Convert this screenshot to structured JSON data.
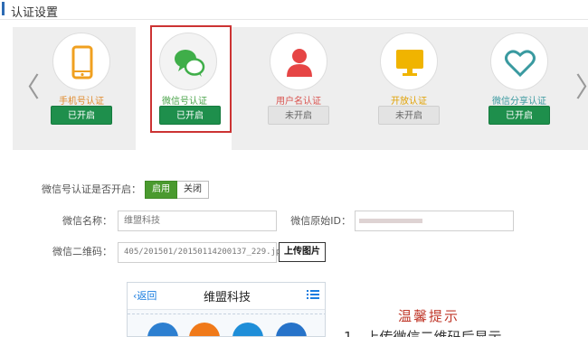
{
  "header": {
    "title": "认证设置"
  },
  "carousel": {
    "prev_arrow": "〈",
    "next_arrow": "〉",
    "cards": [
      {
        "icon": "phone-icon",
        "label": "手机号认证",
        "status": "已开启",
        "enabled": true,
        "label_color": "#e08a2c"
      },
      {
        "icon": "wechat-icon",
        "label": "微信号认证",
        "status": "已开启",
        "enabled": true,
        "label_color": "#4aa44a",
        "selected": true
      },
      {
        "icon": "user-icon",
        "label": "用户名认证",
        "status": "未开启",
        "enabled": false,
        "label_color": "#d9534f"
      },
      {
        "icon": "monitor-icon",
        "label": "开放认证",
        "status": "未开启",
        "enabled": false,
        "label_color": "#e0a000"
      },
      {
        "icon": "heart-icon",
        "label": "微信分享认证",
        "status": "已开启",
        "enabled": true,
        "label_color": "#3a9aa0"
      }
    ]
  },
  "form": {
    "enable_label": "微信号认证是否开启：",
    "enable_on": "启用",
    "enable_off": "关闭",
    "name_label": "微信名称：",
    "name_value": "维盟科技",
    "origin_label": "微信原始ID：",
    "qr_label": "微信二维码：",
    "qr_value": "405/201501/20150114200137_229.jpg",
    "upload_label": "上传图片"
  },
  "preview": {
    "back": "返回",
    "title": "维盟科技"
  },
  "tips": {
    "title": "温馨提示",
    "line": "1、上传微信二维码后显示"
  },
  "colors": {
    "accent_green": "#1e8f4c",
    "selected_border": "#cc3333",
    "header_bar": "#2d6bb3"
  }
}
